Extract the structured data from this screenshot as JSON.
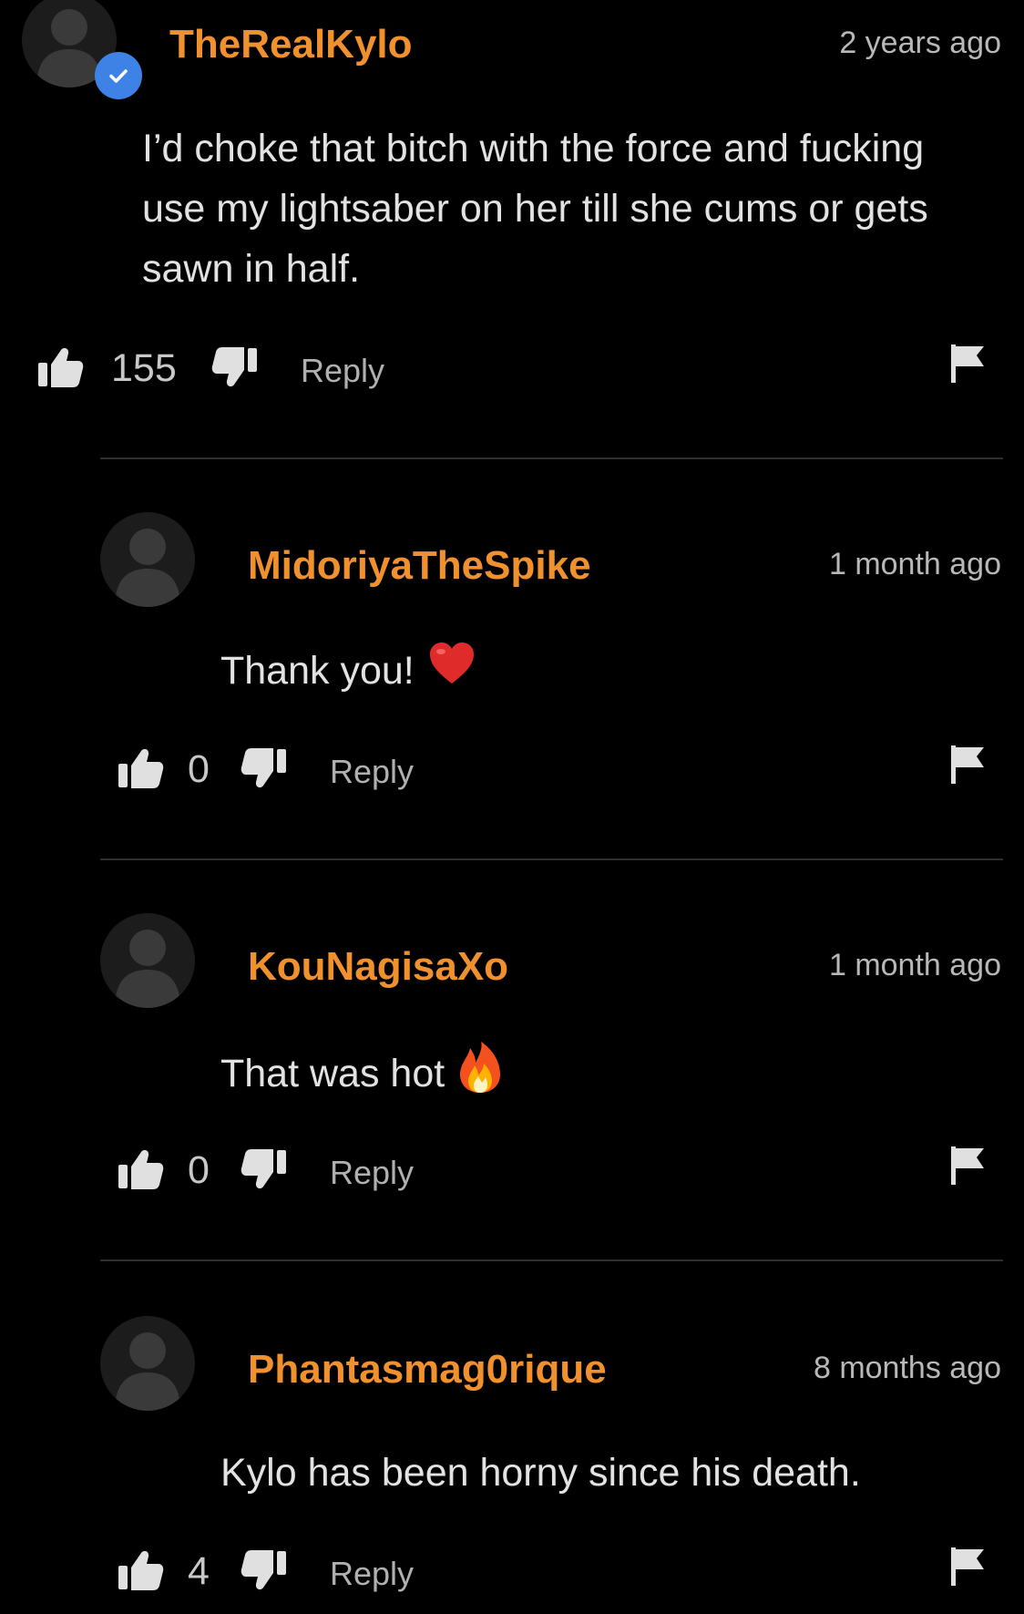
{
  "colors": {
    "background": "#000000",
    "username": "#f0912e",
    "verified_badge": "#3f82e6",
    "icon": "#e0e0e0",
    "divider": "#2f2f2f"
  },
  "comments": [
    {
      "username": "TheRealKylo",
      "timestamp": "2 years ago",
      "verified": true,
      "lines": [
        "I’d choke that bitch with the force and fucking",
        "use my lightsaber on her till she cums or gets",
        "sawn in half."
      ],
      "likes": "155",
      "reply_label": "Reply"
    },
    {
      "username": "MidoriyaTheSpike",
      "timestamp": "1 month ago",
      "text": "Thank you!",
      "emoji": "red-heart-emoji",
      "likes": "0",
      "reply_label": "Reply"
    },
    {
      "username": "KouNagisaXo",
      "timestamp": "1 month ago",
      "text": "That was hot",
      "emoji": "fire-emoji",
      "likes": "0",
      "reply_label": "Reply"
    },
    {
      "username": "Phantasmag0rique",
      "timestamp": "8 months ago",
      "text": "Kylo has been horny since his death.",
      "likes": "4",
      "reply_label": "Reply"
    }
  ]
}
